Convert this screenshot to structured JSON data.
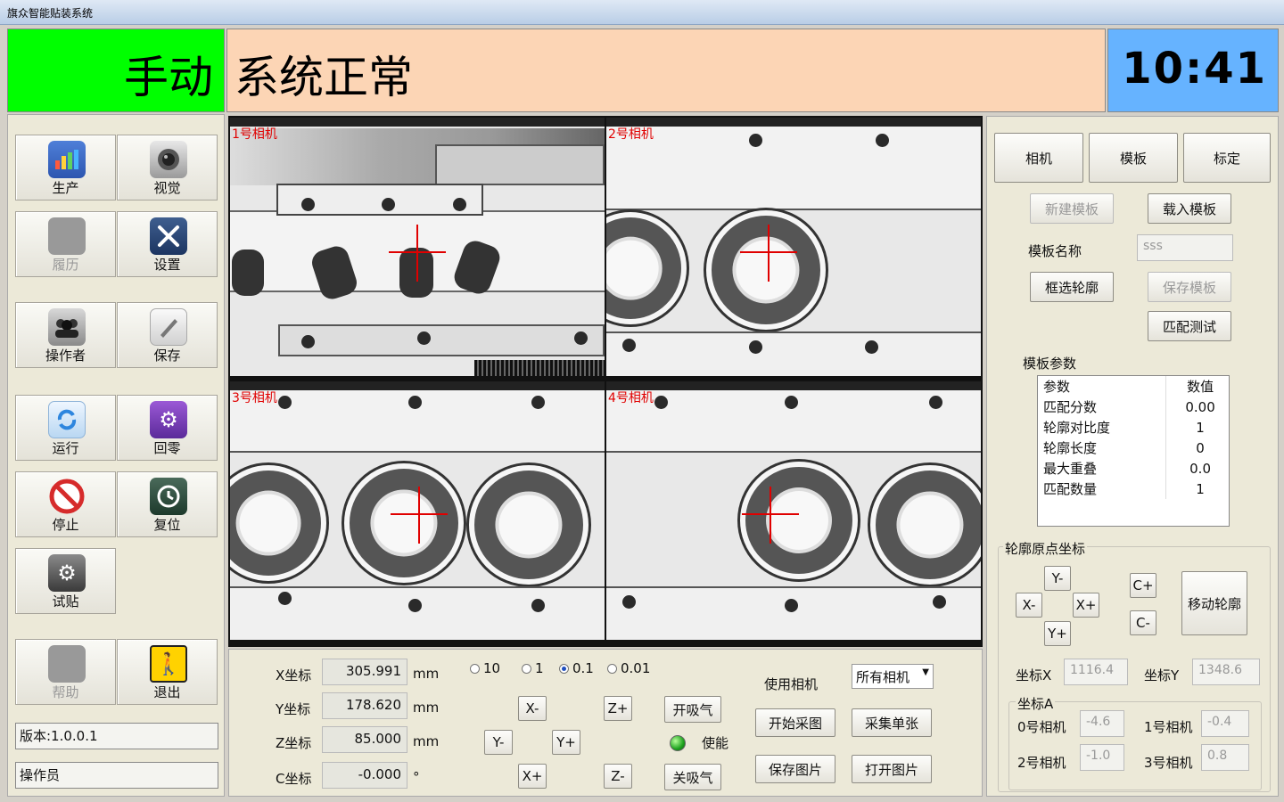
{
  "window": {
    "title": "旗众智能贴装系统"
  },
  "header": {
    "mode": "手动",
    "status": "系统正常",
    "clock": "10:41",
    "colors": {
      "mode": "#00ff00",
      "status": "#fcd5b5",
      "clock": "#66b3ff"
    }
  },
  "sidebar": {
    "tiles": [
      {
        "label": "生产",
        "icon": "bar-chart-icon"
      },
      {
        "label": "视觉",
        "icon": "camera-icon"
      },
      {
        "label": "履历",
        "icon": "history-icon"
      },
      {
        "label": "设置",
        "icon": "tools-icon"
      },
      {
        "label": "操作者",
        "icon": "users-icon"
      },
      {
        "label": "保存",
        "icon": "pen-icon"
      },
      {
        "label": "运行",
        "icon": "refresh-icon"
      },
      {
        "label": "回零",
        "icon": "gear-icon"
      },
      {
        "label": "停止",
        "icon": "stop-icon"
      },
      {
        "label": "复位",
        "icon": "clock-reset-icon"
      },
      {
        "label": "试贴",
        "icon": "cog-icon"
      },
      {
        "label": "帮助",
        "icon": "help-icon"
      },
      {
        "label": "退出",
        "icon": "exit-icon"
      }
    ],
    "version": "版本:1.0.0.1",
    "operator": "操作员"
  },
  "cameras": [
    {
      "label": "1号相机"
    },
    {
      "label": "2号相机"
    },
    {
      "label": "3号相机"
    },
    {
      "label": "4号相机"
    }
  ],
  "coords": {
    "x_label": "X坐标",
    "x_value": "305.991",
    "x_unit": "mm",
    "y_label": "Y坐标",
    "y_value": "178.620",
    "y_unit": "mm",
    "z_label": "Z坐标",
    "z_value": "85.000",
    "z_unit": "mm",
    "c_label": "C坐标",
    "c_value": "-0.000",
    "c_unit": "°"
  },
  "step": {
    "options": [
      "10",
      "1",
      "0.1",
      "0.01"
    ],
    "selected": "0.1"
  },
  "jog": {
    "x_minus": "X-",
    "x_plus": "X+",
    "y_minus": "Y-",
    "y_plus": "Y+",
    "z_plus": "Z+",
    "z_minus": "Z-"
  },
  "vacuum": {
    "open": "开吸气",
    "close": "关吸气",
    "enable": "使能"
  },
  "camera_ctrl": {
    "use_label": "使用相机",
    "select": "所有相机",
    "start": "开始采图",
    "single": "采集单张",
    "save": "保存图片",
    "open": "打开图片"
  },
  "right": {
    "tabs": [
      "相机",
      "模板",
      "标定"
    ],
    "new_template": "新建模板",
    "load_template": "载入模板",
    "name_label": "模板名称",
    "name_value": "sss",
    "select_contour": "框选轮廓",
    "save_template": "保存模板",
    "match_test": "匹配测试",
    "params_title": "模板参数",
    "params_header": [
      "参数",
      "数值"
    ],
    "params": [
      [
        "匹配分数",
        "0.00"
      ],
      [
        "轮廓对比度",
        "1"
      ],
      [
        "轮廓长度",
        "0"
      ],
      [
        "最大重叠",
        "0.0"
      ],
      [
        "匹配数量",
        "1"
      ]
    ],
    "origin_title": "轮廓原点坐标",
    "origin_jog": {
      "y_minus": "Y-",
      "x_minus": "X-",
      "x_plus": "X+",
      "y_plus": "Y+",
      "c_plus": "C+",
      "c_minus": "C-"
    },
    "move_contour": "移动轮廓",
    "coord_x_label": "坐标X",
    "coord_x": "1116.4",
    "coord_y_label": "坐标Y",
    "coord_y": "1348.6",
    "coord_a_label": "坐标A",
    "cam0_label": "0号相机",
    "cam0": "-4.6",
    "cam1_label": "1号相机",
    "cam1": "-0.4",
    "cam2_label": "2号相机",
    "cam2": "-1.0",
    "cam3_label": "3号相机",
    "cam3": "0.8"
  }
}
